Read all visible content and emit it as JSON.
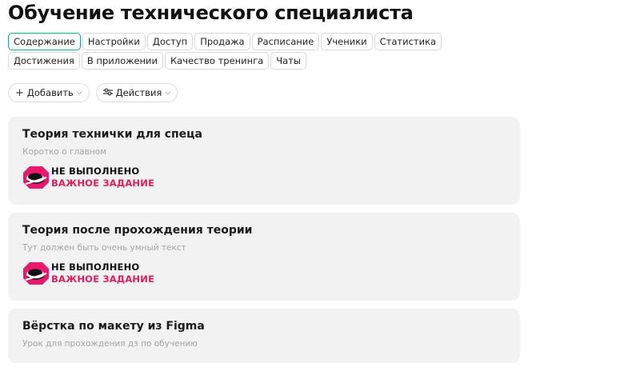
{
  "page": {
    "title": "Обучение технического специалиста"
  },
  "tabs": [
    {
      "label": "Содержание",
      "active": true
    },
    {
      "label": "Настройки"
    },
    {
      "label": "Доступ"
    },
    {
      "label": "Продажа"
    },
    {
      "label": "Расписание"
    },
    {
      "label": "Ученики"
    },
    {
      "label": "Статистика"
    },
    {
      "label": "Достижения"
    },
    {
      "label": "В приложении"
    },
    {
      "label": "Качество тренинга"
    },
    {
      "label": "Чаты"
    }
  ],
  "toolbar": {
    "add_label": "Добавить",
    "actions_label": "Действия"
  },
  "lessons": [
    {
      "title": "Теория технички для спеца",
      "subtitle": "Коротко о главном",
      "status": "НЕ ВЫПОЛНЕНО",
      "important": "ВАЖНОЕ ЗАДАНИЕ"
    },
    {
      "title": "Теория после прохождения теории",
      "subtitle": "Тут должен быть очень умный текст",
      "status": "НЕ ВЫПОЛНЕНО",
      "important": "ВАЖНОЕ ЗАДАНИЕ"
    },
    {
      "title": "Вёрстка по макету из Figma",
      "subtitle": "Урок для прохождения дз по обучению"
    }
  ],
  "colors": {
    "active_tab_border": "#1aa690",
    "important_text": "#e21e5c",
    "badge_icon": "#e8186d",
    "card_background": "#f2f2f2"
  }
}
